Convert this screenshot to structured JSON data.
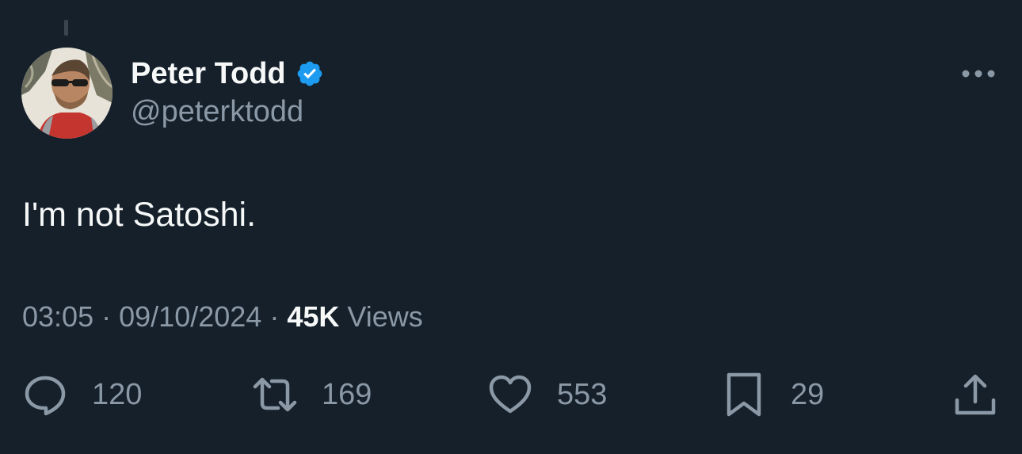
{
  "tweet": {
    "author": {
      "display_name": "Peter Todd",
      "handle": "@peterktodd",
      "verified": true,
      "avatar_icon": "profile-photo"
    },
    "text": "I'm not Satoshi.",
    "meta": {
      "time": "03:05",
      "separator": "·",
      "date": "09/10/2024",
      "views_count": "45K",
      "views_label": "Views"
    },
    "actions": {
      "replies": "120",
      "retweets": "169",
      "likes": "553",
      "bookmarks": "29"
    }
  },
  "colors": {
    "background": "#15202b",
    "primary_text": "#f7f9f9",
    "secondary_text": "#8b98a5",
    "verified_badge": "#1d9bf0"
  }
}
